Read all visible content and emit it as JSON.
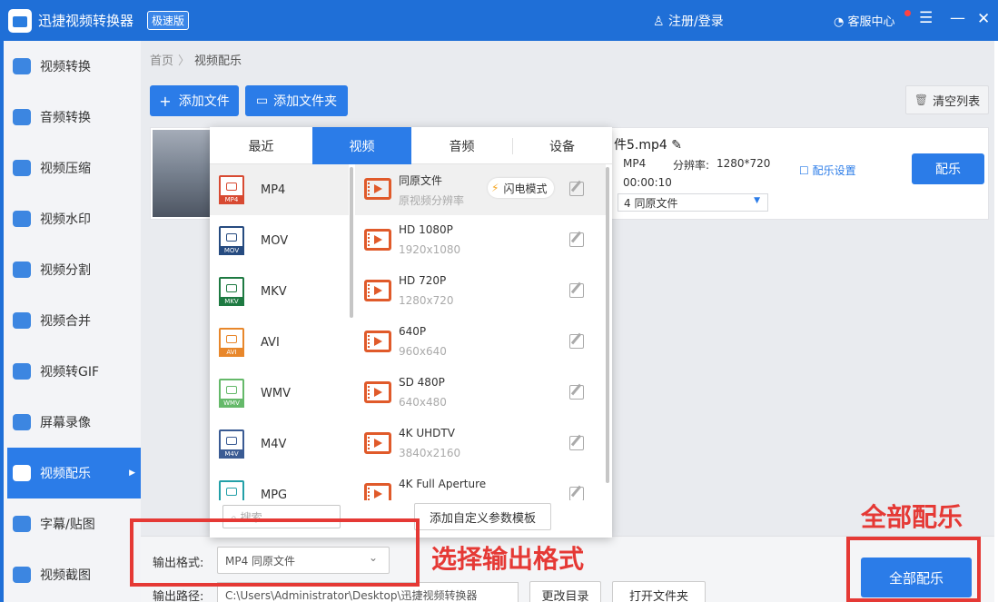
{
  "titlebar": {
    "app_title": "迅捷视频转换器",
    "edition": "极速版",
    "user_label": "注册/登录",
    "service_label": "客服中心",
    "menu_glyph": "☰",
    "min_glyph": "—",
    "close_glyph": "✕"
  },
  "sidebar": {
    "items": [
      {
        "label": "视频转换",
        "icon": "video-convert-icon",
        "active": false
      },
      {
        "label": "音频转换",
        "icon": "audio-convert-icon",
        "active": false
      },
      {
        "label": "视频压缩",
        "icon": "compress-icon",
        "active": false
      },
      {
        "label": "视频水印",
        "icon": "watermark-icon",
        "active": false
      },
      {
        "label": "视频分割",
        "icon": "split-icon",
        "active": false
      },
      {
        "label": "视频合并",
        "icon": "merge-icon",
        "active": false
      },
      {
        "label": "视频转GIF",
        "icon": "gif-icon",
        "active": false
      },
      {
        "label": "屏幕录像",
        "icon": "record-icon",
        "active": false
      },
      {
        "label": "视频配乐",
        "icon": "music-icon",
        "active": true
      },
      {
        "label": "字幕/贴图",
        "icon": "subtitle-icon",
        "active": false
      },
      {
        "label": "视频截图",
        "icon": "screenshot-icon",
        "active": false
      }
    ],
    "active_arrow": "▶"
  },
  "breadcrumb": {
    "home": "首页",
    "sep": "〉",
    "current": "视频配乐"
  },
  "toolbar": {
    "add_file": "添加文件",
    "add_folder": "添加文件夹",
    "clear_list": "清空列表",
    "plus": "+",
    "folder_glyph": "▭",
    "trash_glyph": "🗑"
  },
  "file": {
    "name": "件5.mp4",
    "format": "MP4",
    "res_label": "分辨率:",
    "resolution": "1280*720",
    "duration": "00:00:10",
    "select_value": "4  同原文件",
    "music_setting": "配乐设置",
    "music_button": "配乐",
    "caret": "▼",
    "pencil": "✎",
    "setting_glyph": "☐"
  },
  "popup": {
    "tabs": [
      "最近",
      "视频",
      "音频",
      "设备"
    ],
    "active_tab": 1,
    "formats": [
      {
        "label": "MP4",
        "color": "#d84a32"
      },
      {
        "label": "MOV",
        "color": "#264b80"
      },
      {
        "label": "MKV",
        "color": "#1e7a42"
      },
      {
        "label": "AVI",
        "color": "#e8872b"
      },
      {
        "label": "WMV",
        "color": "#65b96a"
      },
      {
        "label": "M4V",
        "color": "#3a5b94"
      },
      {
        "label": "MPG",
        "color": "#23a0a8"
      }
    ],
    "resolutions": [
      {
        "name": "同原文件",
        "sub": "原视频分辨率"
      },
      {
        "name": "HD 1080P",
        "sub": "1920x1080"
      },
      {
        "name": "HD 720P",
        "sub": "1280x720"
      },
      {
        "name": "640P",
        "sub": "960x640"
      },
      {
        "name": "SD 480P",
        "sub": "640x480"
      },
      {
        "name": "4K UHDTV",
        "sub": "3840x2160"
      },
      {
        "name": "4K Full Aperture",
        "sub": ""
      }
    ],
    "flash_mode": "闪电模式",
    "bolt": "⚡",
    "search_placeholder": "搜索",
    "search_glyph": "⌕",
    "add_template": "添加自定义参数模板"
  },
  "bottom": {
    "output_format_label": "输出格式:",
    "output_format_value": "MP4  同原文件",
    "chevron": "⌄",
    "output_path_label": "输出路径:",
    "output_path_value": "C:\\Users\\Administrator\\Desktop\\迅捷视频转换器",
    "change_dir": "更改目录",
    "open_folder": "打开文件夹",
    "all_music": "全部配乐"
  },
  "annotations": {
    "select_format": "选择输出格式",
    "all_music": "全部配乐",
    "color": "#e53935"
  },
  "colors": {
    "primary": "#2b7ce8",
    "titlebar": "#1f6fd7"
  }
}
